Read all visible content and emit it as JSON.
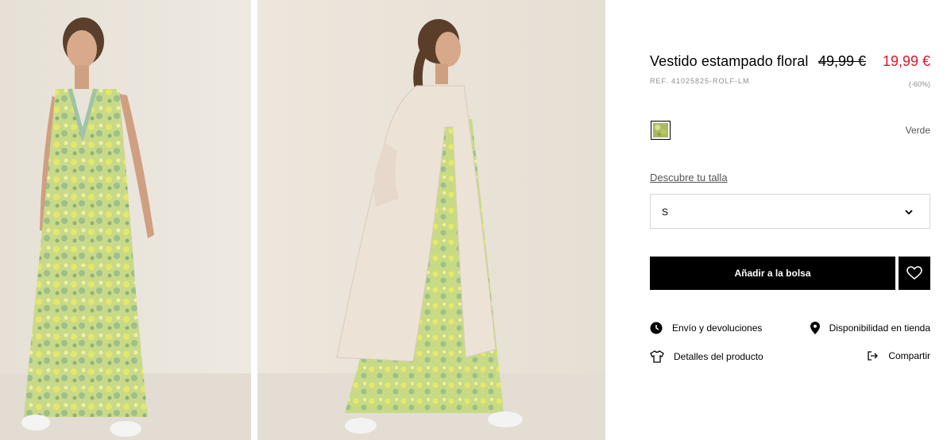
{
  "product": {
    "title": "Vestido estampado floral",
    "old_price": "49,99 €",
    "new_price": "19,99 €",
    "ref": "REF. 41025825-ROLF-LM",
    "discount": "(-60%)",
    "color_name": "Verde"
  },
  "size": {
    "guide_link": "Descubre tu talla",
    "selected": "S"
  },
  "buttons": {
    "add_to_bag": "Añadir a la bolsa"
  },
  "actions": {
    "shipping": "Envío y devoluciones",
    "store": "Disponibilidad en tienda",
    "details": "Detalles del producto",
    "share": "Compartir"
  },
  "icons": {
    "photo_1": "model-front-view-image",
    "photo_2": "model-side-view-image",
    "swatch": "green-floral-swatch",
    "chevron": "chevron-down-icon",
    "heart": "heart-icon",
    "clock": "clock-icon",
    "pin": "location-pin-icon",
    "shirt": "shirt-icon",
    "share": "share-arrow-icon"
  },
  "colors": {
    "sale": "#e0142d",
    "button": "#000000",
    "muted": "#8c8c8c"
  }
}
